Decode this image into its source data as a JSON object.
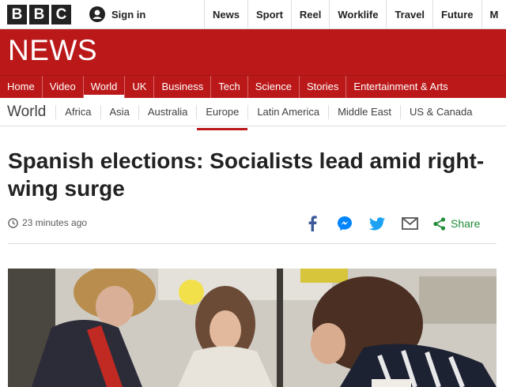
{
  "brand": {
    "letters": [
      "B",
      "B",
      "C"
    ]
  },
  "account": {
    "signin_label": "Sign in"
  },
  "top_nav": [
    "News",
    "Sport",
    "Reel",
    "Worklife",
    "Travel",
    "Future",
    "M"
  ],
  "news_title": "NEWS",
  "section_nav": {
    "items": [
      "Home",
      "Video",
      "World",
      "UK",
      "Business",
      "Tech",
      "Science",
      "Stories",
      "Entertainment & Arts"
    ],
    "active": "World"
  },
  "sub_nav": {
    "section": "World",
    "items": [
      "Africa",
      "Asia",
      "Australia",
      "Europe",
      "Latin America",
      "Middle East",
      "US & Canada"
    ],
    "active": "Europe"
  },
  "article": {
    "headline": "Spanish elections: Socialists lead amid right-wing surge",
    "timestamp": "23 minutes ago"
  },
  "share": {
    "icons": [
      "facebook-icon",
      "messenger-icon",
      "twitter-icon",
      "email-icon"
    ],
    "label": "Share"
  },
  "colors": {
    "brand_red": "#bb1919",
    "share_green": "#218c3a",
    "facebook_blue": "#3b5998",
    "messenger_blue": "#0084ff",
    "twitter_blue": "#1da1f2"
  }
}
